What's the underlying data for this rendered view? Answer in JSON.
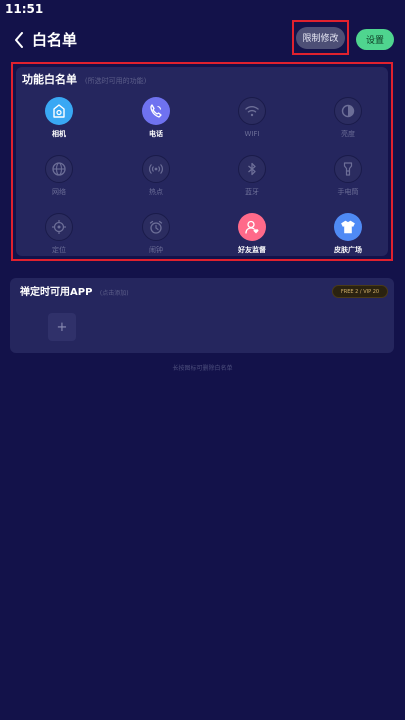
{
  "status_bar": {
    "time": "11:51"
  },
  "header": {
    "title": "白名单",
    "limit_label": "限制修改",
    "reset_label": "设置"
  },
  "functions": {
    "title": "功能白名单",
    "hint": "(所选时可用的功能)",
    "items": [
      {
        "label": "相机",
        "active": true,
        "icon": "camera-icon"
      },
      {
        "label": "电话",
        "active": true,
        "icon": "phone-icon"
      },
      {
        "label": "WIFI",
        "active": false,
        "icon": "wifi-icon"
      },
      {
        "label": "亮度",
        "active": false,
        "icon": "brightness-icon"
      },
      {
        "label": "网络",
        "active": false,
        "icon": "globe-icon"
      },
      {
        "label": "热点",
        "active": false,
        "icon": "hotspot-icon"
      },
      {
        "label": "蓝牙",
        "active": false,
        "icon": "bluetooth-icon"
      },
      {
        "label": "手电筒",
        "active": false,
        "icon": "flashlight-icon"
      },
      {
        "label": "定位",
        "active": false,
        "icon": "location-icon"
      },
      {
        "label": "闹钟",
        "active": false,
        "icon": "alarm-icon"
      },
      {
        "label": "好友监督",
        "active": true,
        "icon": "friend-supervise-icon"
      },
      {
        "label": "皮肤广场",
        "active": true,
        "icon": "skin-shirt-icon"
      }
    ],
    "colors": {
      "camera": "#39a8f4",
      "phone": "#6f72f0",
      "friend": "#ff6a8a",
      "skin": "#4f8af5"
    }
  },
  "app_section": {
    "title": "禅定时可用APP",
    "hint": "(点击添加)",
    "badge": "FREE 2 / VIP 20",
    "add_symbol": "+"
  },
  "footer_hint": "长按图标可删除白名单"
}
